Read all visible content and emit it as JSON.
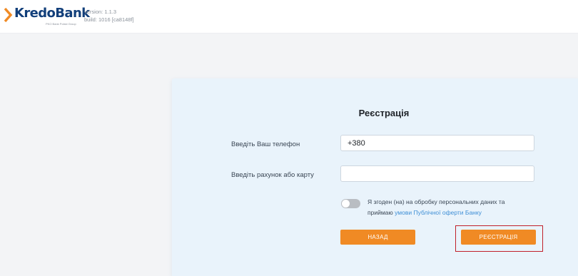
{
  "header": {
    "logo_text": "KredoBank",
    "logo_subtitle": "PKO Bank Polski Group",
    "version_text": "version: 1.1.3",
    "build_text": "build: 1016 [ca8148f]"
  },
  "form": {
    "title": "Реєстрація",
    "phone_label": "Введіть Ваш телефон",
    "phone_value": "+380",
    "account_label": "Введіть рахунок або карту",
    "account_value": "",
    "consent_text": "Я згоден (на) на обробку персональних даних та приймаю",
    "consent_link": "умови Публічної оферти Банку",
    "consent_checked": false,
    "back_button": "НАЗАД",
    "register_button": "РЕЄСТРАЦІЯ"
  },
  "colors": {
    "brand_blue": "#123f7a",
    "brand_orange": "#f08a24",
    "panel_bg": "#e9f3fb",
    "link_blue": "#3f8fd6",
    "highlight_red": "#c0202a"
  },
  "icons": {
    "logo_mark": "orange-chevron-icon"
  }
}
